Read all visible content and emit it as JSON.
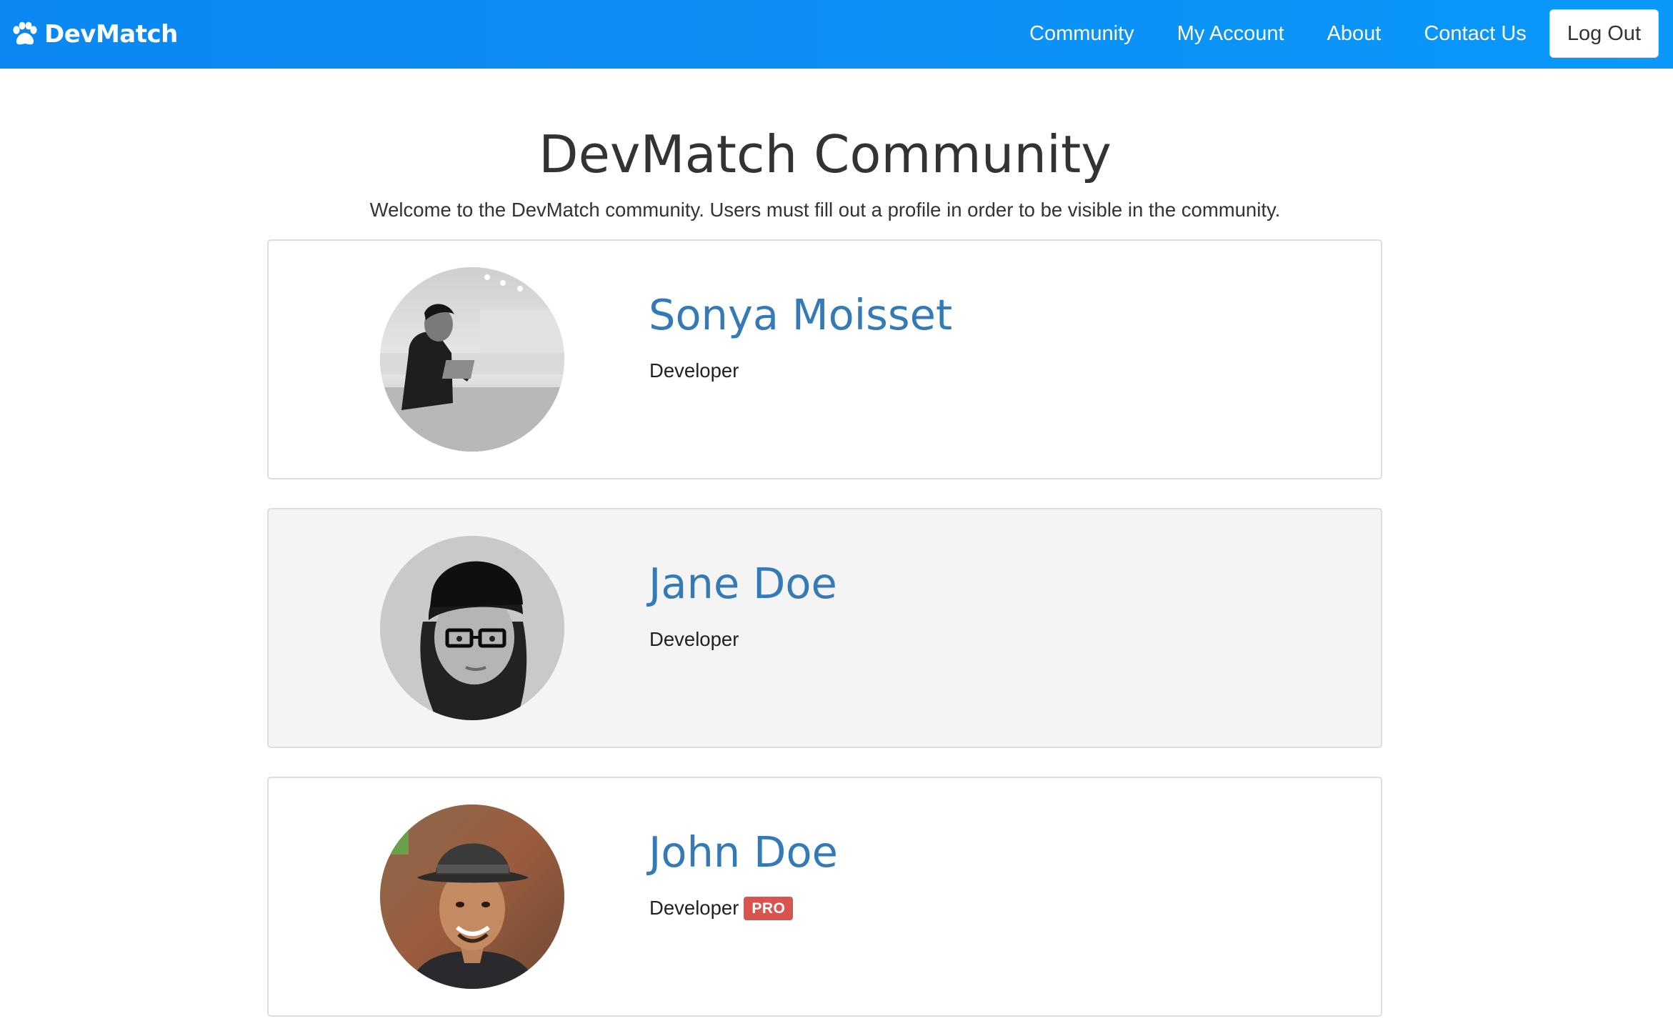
{
  "nav": {
    "brand": "DevMatch",
    "links": [
      "Community",
      "My Account",
      "About",
      "Contact Us"
    ],
    "logout": "Log Out",
    "brand_color": "#0a8ff5"
  },
  "header": {
    "title": "DevMatch Community",
    "subtitle": "Welcome to the DevMatch community. Users must fill out a profile in order to be visible in the community."
  },
  "profiles": [
    {
      "name": "Sonya Moisset",
      "role": "Developer",
      "badge": ""
    },
    {
      "name": "Jane Doe",
      "role": "Developer",
      "badge": ""
    },
    {
      "name": "John Doe",
      "role": "Developer",
      "badge": "PRO"
    }
  ],
  "colors": {
    "name_link": "#337ab7",
    "pro_badge": "#d9534f",
    "card_alt_bg": "#f4f4f4"
  }
}
